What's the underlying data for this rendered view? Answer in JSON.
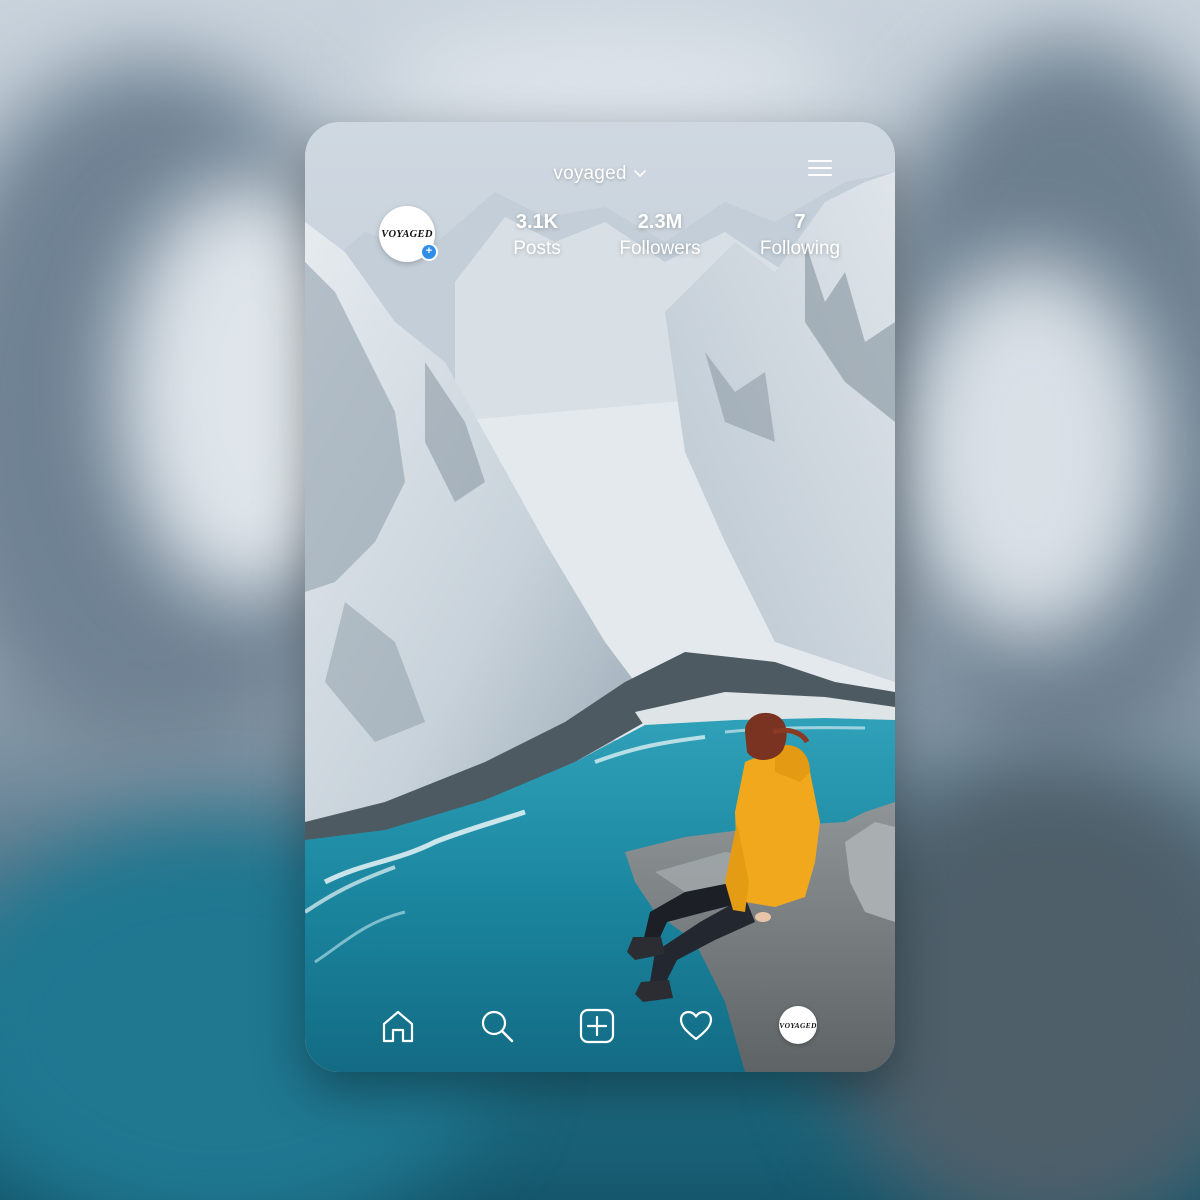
{
  "profile": {
    "username": "voyaged",
    "avatar_text": "VOYAGED",
    "stats": [
      {
        "value": "3.1K",
        "label": "Posts"
      },
      {
        "value": "2.3M",
        "label": "Followers"
      },
      {
        "value": "7",
        "label": "Following"
      }
    ]
  },
  "icons": {
    "username_dropdown": "chevron-down-icon",
    "menu": "hamburger-menu-icon",
    "avatar_badge": "plus-badge-icon"
  },
  "nav": {
    "items": [
      {
        "icon": "home-icon"
      },
      {
        "icon": "search-icon"
      },
      {
        "icon": "add-post-icon"
      },
      {
        "icon": "heart-icon"
      },
      {
        "icon": "profile-avatar-icon",
        "avatar_text": "VOYAGED"
      }
    ]
  },
  "colors": {
    "accent": "#2f8fe8",
    "text_on_image": "#ffffff",
    "water": "#1f8ea6",
    "jacket": "#f2a81d"
  }
}
